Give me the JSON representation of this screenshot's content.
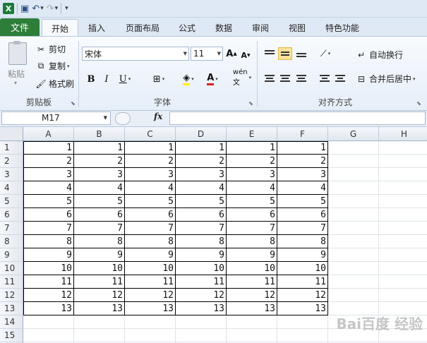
{
  "qat": {
    "undo_icon": "undo-icon",
    "redo_icon": "redo-icon",
    "save_icon": "save-icon"
  },
  "tabs": [
    {
      "label": "文件"
    },
    {
      "label": "开始"
    },
    {
      "label": "插入"
    },
    {
      "label": "页面布局"
    },
    {
      "label": "公式"
    },
    {
      "label": "数据"
    },
    {
      "label": "审阅"
    },
    {
      "label": "视图"
    },
    {
      "label": "特色功能"
    }
  ],
  "clipboard": {
    "paste": "粘贴",
    "cut": "剪切",
    "copy": "复制",
    "format_painter": "格式刷",
    "group": "剪贴板"
  },
  "font": {
    "name": "宋体",
    "size": "11",
    "bold": "B",
    "italic": "I",
    "underline": "U",
    "group": "字体",
    "grow": "A",
    "shrink": "A"
  },
  "alignment": {
    "wrap": "自动换行",
    "merge": "合并后居中",
    "group": "对齐方式"
  },
  "formula_bar": {
    "name_box": "M17",
    "fx": "fx"
  },
  "columns": [
    "A",
    "B",
    "C",
    "D",
    "E",
    "F",
    "G",
    "H"
  ],
  "rows": [
    "1",
    "2",
    "3",
    "4",
    "5",
    "6",
    "7",
    "8",
    "9",
    "10",
    "11",
    "12",
    "13",
    "14",
    "15",
    "16"
  ],
  "cells": [
    [
      "1",
      "1",
      "1",
      "1",
      "1",
      "1"
    ],
    [
      "2",
      "2",
      "2",
      "2",
      "2",
      "2"
    ],
    [
      "3",
      "3",
      "3",
      "3",
      "3",
      "3"
    ],
    [
      "4",
      "4",
      "4",
      "4",
      "4",
      "4"
    ],
    [
      "5",
      "5",
      "5",
      "5",
      "5",
      "5"
    ],
    [
      "6",
      "6",
      "6",
      "6",
      "6",
      "6"
    ],
    [
      "7",
      "7",
      "7",
      "7",
      "7",
      "7"
    ],
    [
      "8",
      "8",
      "8",
      "8",
      "8",
      "8"
    ],
    [
      "9",
      "9",
      "9",
      "9",
      "9",
      "9"
    ],
    [
      "10",
      "10",
      "10",
      "10",
      "10",
      "10"
    ],
    [
      "11",
      "11",
      "11",
      "11",
      "11",
      "11"
    ],
    [
      "12",
      "12",
      "12",
      "12",
      "12",
      "12"
    ],
    [
      "13",
      "13",
      "13",
      "13",
      "13",
      "13"
    ]
  ],
  "watermark": "Bai百度 经验"
}
